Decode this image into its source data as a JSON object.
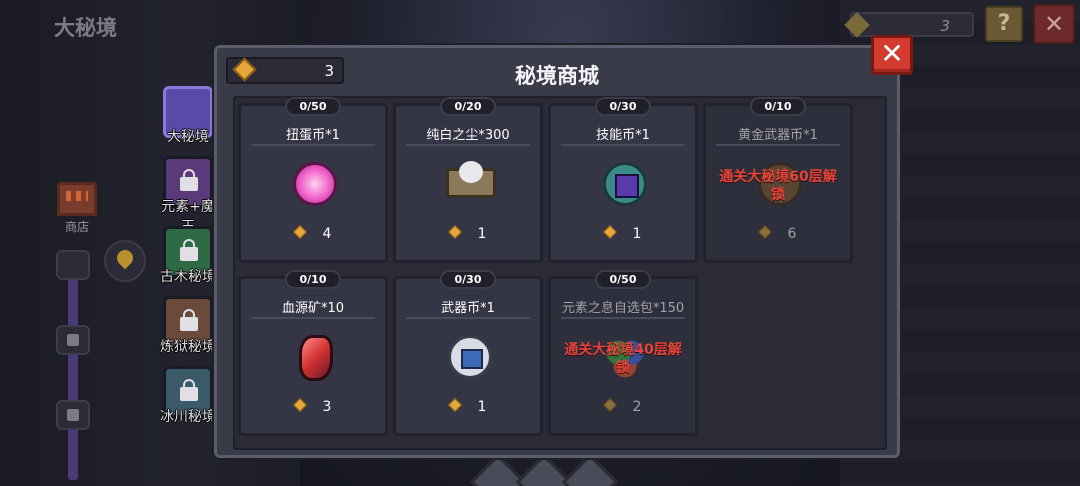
{
  "background": {
    "title": "大秘境",
    "top_counter": "3",
    "help_label": "?",
    "close_label": "✕",
    "shop_label": "商店"
  },
  "tabs": [
    {
      "label": "大秘境",
      "active": true,
      "color": "#5a4aa8"
    },
    {
      "label": "元素+魔王",
      "active": false,
      "color": "#5a3a7a"
    },
    {
      "label": "古木秘境",
      "active": false,
      "color": "#2e6a44"
    },
    {
      "label": "炼狱秘境",
      "active": false,
      "color": "#6a4a3a"
    },
    {
      "label": "冰川秘境",
      "active": false,
      "color": "#3a5a6a"
    }
  ],
  "panel": {
    "title": "秘境商城",
    "currency": "3",
    "close_label": "✕"
  },
  "items": [
    {
      "stock": "0/50",
      "name": "扭蛋币*1",
      "price": "4",
      "locked": false,
      "lock_msg": "",
      "icon": "gacha-coin-icon"
    },
    {
      "stock": "0/20",
      "name": "纯白之尘*300",
      "price": "1",
      "locked": false,
      "lock_msg": "",
      "icon": "white-dust-icon"
    },
    {
      "stock": "0/30",
      "name": "技能币*1",
      "price": "1",
      "locked": false,
      "lock_msg": "",
      "icon": "skill-coin-icon"
    },
    {
      "stock": "0/10",
      "name": "黄金武器币*1",
      "price": "6",
      "locked": true,
      "lock_msg": "通关大秘境60层解锁",
      "icon": "gold-weapon-coin-icon"
    },
    {
      "stock": "0/10",
      "name": "血源矿*10",
      "price": "3",
      "locked": false,
      "lock_msg": "",
      "icon": "blood-ore-icon"
    },
    {
      "stock": "0/30",
      "name": "武器币*1",
      "price": "1",
      "locked": false,
      "lock_msg": "",
      "icon": "weapon-coin-icon"
    },
    {
      "stock": "0/50",
      "name": "元素之息自选包*150",
      "price": "2",
      "locked": true,
      "lock_msg": "通关大秘境40层解锁",
      "icon": "element-pack-icon"
    }
  ]
}
